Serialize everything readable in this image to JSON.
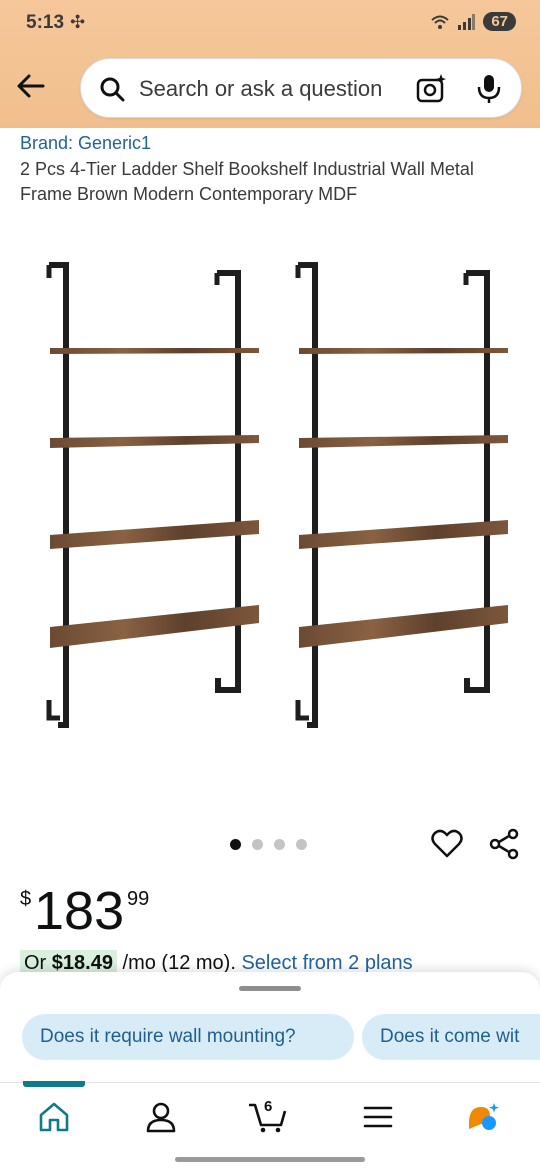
{
  "status_bar": {
    "time": "5:13",
    "battery": "67",
    "wifi_label": "5"
  },
  "search": {
    "placeholder": "Search or ask a question"
  },
  "product": {
    "brand": "Brand: Generic1",
    "title": "2 Pcs 4-Tier Ladder Shelf Bookshelf Industrial Wall Metal Frame Brown Modern Contemporary MDF",
    "image_count": 4,
    "active_image": 1
  },
  "price": {
    "currency": "$",
    "whole": "183",
    "fraction": "99"
  },
  "financing": {
    "prefix": "Or ",
    "monthly_amount": "$18.49",
    "term": " /mo (12 mo). ",
    "link": "Select from 2 plans"
  },
  "questions": {
    "chip_1": "Does it require wall mounting?",
    "chip_2": "Does it come wit"
  },
  "nav": {
    "cart_count": "6"
  },
  "colors": {
    "header_bg": "#f5c79a",
    "link": "#2162a1",
    "chip_bg": "#d8ecf8",
    "nav_accent": "#0e7b8c"
  }
}
